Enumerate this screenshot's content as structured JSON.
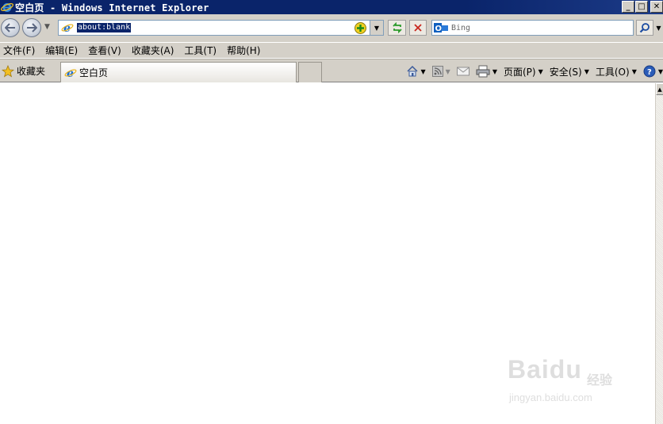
{
  "window": {
    "title": "空白页 - Windows Internet Explorer",
    "buttons": {
      "minimize": "_",
      "maximize": "□",
      "close": "✕"
    }
  },
  "address_bar": {
    "url": "about:blank",
    "dropdown_glyph": "▼"
  },
  "search": {
    "provider_icon": "outlook-icon",
    "placeholder": "Bing"
  },
  "menu": [
    {
      "label": "文件(F)"
    },
    {
      "label": "编辑(E)"
    },
    {
      "label": "查看(V)"
    },
    {
      "label": "收藏夹(A)"
    },
    {
      "label": "工具(T)"
    },
    {
      "label": "帮助(H)"
    }
  ],
  "favorites": {
    "label": "收藏夹"
  },
  "tab": {
    "label": "空白页"
  },
  "commands": [
    {
      "label": "页面(P)"
    },
    {
      "label": "安全(S)"
    },
    {
      "label": "工具(O)"
    }
  ],
  "watermark": {
    "brand": "Baidu",
    "brand_cn": "经验",
    "url": "jingyan.baidu.com"
  },
  "colors": {
    "titlebar": "#0a246a",
    "chrome": "#d4d0c8",
    "selection": "#0a246a"
  }
}
